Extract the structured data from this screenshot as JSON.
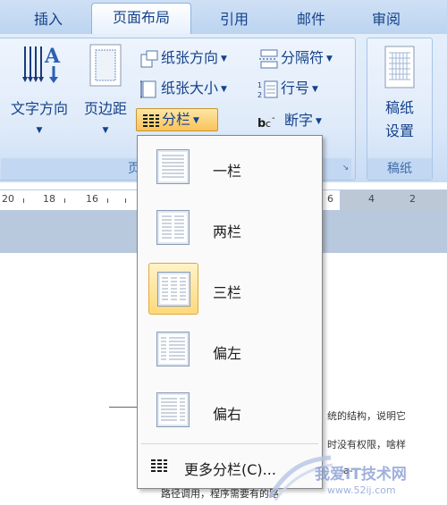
{
  "tabs": [
    {
      "label": "插入"
    },
    {
      "label": "页面布局",
      "active": true
    },
    {
      "label": "引用"
    },
    {
      "label": "邮件"
    },
    {
      "label": "审阅"
    }
  ],
  "page_setup": {
    "caption": "页",
    "text_direction": "文字方向",
    "margins": "页边距",
    "orientation": "纸张方向",
    "size": "纸张大小",
    "columns": "分栏",
    "breaks": "分隔符",
    "line_numbers": "行号",
    "hyphenation": "断字"
  },
  "manuscript": {
    "caption": "稿纸",
    "button_line1": "稿纸",
    "button_line2": "设置"
  },
  "ruler": {
    "numbers": [
      "20",
      "18",
      "16",
      "6",
      "4",
      "2"
    ]
  },
  "columns_menu": {
    "items": [
      {
        "label": "一栏",
        "cols": 1
      },
      {
        "label": "两栏",
        "cols": 2
      },
      {
        "label": "三栏",
        "cols": 3,
        "selected": true
      },
      {
        "label": "偏左",
        "cols": 2
      },
      {
        "label": "偏右",
        "cols": 2
      }
    ],
    "more": "更多分栏(C)..."
  },
  "document": {
    "line1": "统的结构，说明它",
    "line2": "时没有权限，啥样",
    "line3": "路径调用，程序需要有的路",
    "line4": "-a-"
  },
  "watermark": {
    "text": "我爱IT技术网",
    "url": "www.52ij.com"
  },
  "colors": {
    "ribbon": "#dbe8f9",
    "tab_text": "#15428b",
    "pressed": "#f9c35a",
    "selected_item": "#fdd97a"
  }
}
